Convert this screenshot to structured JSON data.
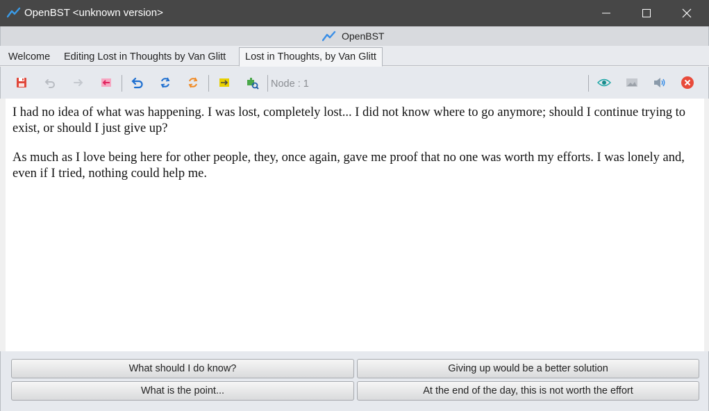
{
  "window": {
    "title": "OpenBST <unknown version>"
  },
  "appbar": {
    "brand": "OpenBST"
  },
  "tabs": [
    {
      "label": "Welcome",
      "active": false
    },
    {
      "label": "Editing Lost in Thoughts by Van Glitt",
      "active": false
    },
    {
      "label": "Lost in Thoughts, by Van Glitt",
      "active": true
    }
  ],
  "toolbar": {
    "buttons": [
      "save-icon",
      "undo-icon",
      "redo-icon",
      "back-to-start-icon",
      "return-icon",
      "refresh-icon",
      "reload-icon",
      "jump-icon",
      "plugin-search-icon",
      "eye-icon",
      "image-icon",
      "sound-icon",
      "close-story-icon"
    ],
    "node_label": "Node : 1"
  },
  "story": {
    "paragraphs": [
      "I had no idea of what was happening. I was lost, completely lost... I did not know where to go anymore; should I continue trying to exist, or should I just give up?",
      "As much as I love being here for other people, they, once again, gave me proof that no one was worth my efforts. I was lonely and, even if I tried, nothing could help me."
    ]
  },
  "choices": [
    "What should I do know?",
    "Giving up would be a better solution",
    "What is the point...",
    "At the end of the day, this is not worth the effort"
  ],
  "colors": {
    "titlebar": "#474747",
    "accent_blue": "#3a8ee6",
    "close_red": "#e84a3a",
    "save_red": "#e0473a",
    "orange": "#f08a24",
    "yellow": "#e8d000",
    "green": "#4aa84a"
  }
}
